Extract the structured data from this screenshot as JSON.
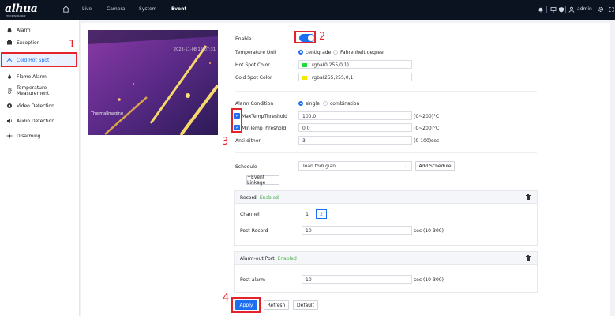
{
  "topbar": {
    "logo": "alhua",
    "logo_sub": "TECHNOLOGY",
    "nav": [
      "Live",
      "Camera",
      "System",
      "Event"
    ],
    "active_nav": "Event",
    "user": "admin"
  },
  "sidebar": {
    "items": [
      {
        "label": "Alarm",
        "icon": "alarm-bell-icon"
      },
      {
        "label": "Exception",
        "icon": "exception-icon"
      },
      {
        "label": "Cold Hot Spot",
        "icon": "hot-spot-icon",
        "active": true
      },
      {
        "label": "Flame Alarm",
        "icon": "flame-icon"
      },
      {
        "label": "Temperature Measurement",
        "icon": "thermometer-icon"
      },
      {
        "label": "Video Detection",
        "icon": "video-detection-icon"
      },
      {
        "label": "Audio Detection",
        "icon": "audio-icon"
      },
      {
        "label": "Disarming",
        "icon": "disarming-icon"
      }
    ]
  },
  "video": {
    "timestamp": "2023-11-08 15:07:31",
    "camera_label": "ThermalImaging"
  },
  "annotations": [
    "1",
    "2",
    "3",
    "4"
  ],
  "form": {
    "enable_label": "Enable",
    "enable_on": true,
    "temp_unit_label": "Temperature Unit",
    "temp_unit_options": [
      "centigrade",
      "Fahrenheit degree"
    ],
    "hot_spot_label": "Hot Spot Color",
    "hot_spot_value": "rgba(0,255,0,1)",
    "hot_spot_color": "#1fdc3a",
    "cold_spot_label": "Cold Spot Color",
    "cold_spot_value": "rgba(255,255,0,1)",
    "cold_spot_color": "#f5e800",
    "alarm_condition_label": "Alarm Condition",
    "alarm_condition_options": [
      "single",
      "combination"
    ],
    "max_label": "MaxTempThreshold",
    "max_value": "100.0",
    "max_range": "[0~200]°C",
    "min_label": "MinTempThreshold",
    "min_value": "0.0",
    "min_range": "[0~200]°C",
    "antidither_label": "Anti-dither",
    "antidither_value": "3",
    "antidither_range": "(0-100)sec",
    "schedule_label": "Schedule",
    "schedule_value": "Toàn thời gian",
    "add_schedule": "Add Schedule",
    "event_linkage": "+Event Linkage"
  },
  "record_panel": {
    "title": "Record",
    "status": "Enabled",
    "channel_label": "Channel",
    "channels": [
      "1",
      "2"
    ],
    "post_record_label": "Post-Record",
    "post_record_value": "10",
    "post_record_unit": "sec (10-300)"
  },
  "alarm_panel": {
    "title": "Alarm-out Port",
    "status": "Enabled",
    "post_alarm_label": "Post-alarm",
    "post_alarm_value": "10",
    "post_alarm_unit": "sec (10-300)"
  },
  "buttons": {
    "apply": "Apply",
    "refresh": "Refresh",
    "default": "Default"
  },
  "colors": {
    "accent": "#1c6ef2",
    "annotation_red": "#e4242b"
  }
}
